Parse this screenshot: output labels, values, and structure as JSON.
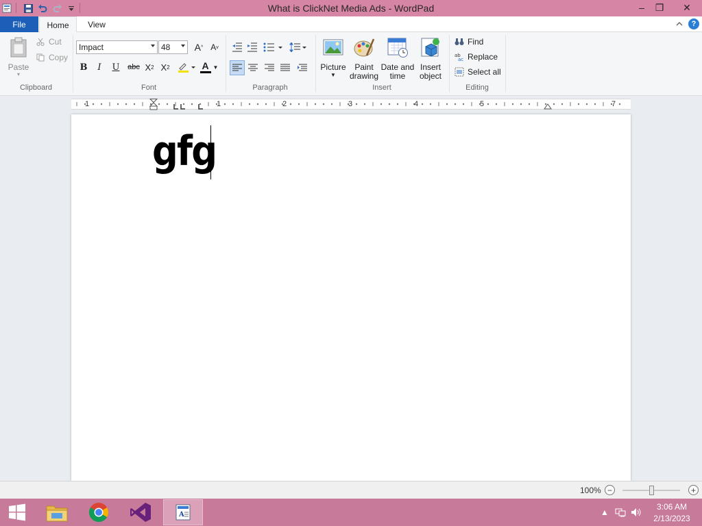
{
  "window": {
    "title": "What is ClickNet Media Ads - WordPad",
    "controls": {
      "minimize": "–",
      "maximize": "❐",
      "close": "✕"
    }
  },
  "ribbon": {
    "tabs": {
      "file": "File",
      "home": "Home",
      "view": "View"
    },
    "help": "?",
    "clipboard": {
      "group": "Clipboard",
      "paste": "Paste",
      "cut": "Cut",
      "copy": "Copy"
    },
    "font": {
      "group": "Font",
      "family": "Impact",
      "size": "48",
      "bold": "B",
      "italic": "I",
      "underline": "U",
      "strikethrough": "abc",
      "subscript_base": "X",
      "subscript_mark": "2",
      "superscript_base": "X",
      "superscript_mark": "2",
      "grow_base": "A",
      "grow_mark": "^",
      "shrink_base": "A",
      "shrink_mark": "v",
      "font_color_letter": "A",
      "font_color": "#000000",
      "highlight_color": "#f5e000"
    },
    "paragraph": {
      "group": "Paragraph"
    },
    "insert": {
      "group": "Insert",
      "picture": "Picture",
      "paint_line1": "Paint",
      "paint_line2": "drawing",
      "datetime_line1": "Date and",
      "datetime_line2": "time",
      "object_line1": "Insert",
      "object_line2": "object"
    },
    "editing": {
      "group": "Editing",
      "find": "Find",
      "replace": "Replace",
      "select_all": "Select all"
    }
  },
  "ruler": {
    "labels": [
      "1",
      "1",
      "2",
      "3",
      "4",
      "5",
      "7"
    ]
  },
  "document": {
    "text": "gfg"
  },
  "statusbar": {
    "zoom": "100%",
    "zoom_out": "−",
    "zoom_in": "+"
  },
  "taskbar": {
    "apps": [
      "start",
      "file-explorer",
      "chrome",
      "visual-studio",
      "wordpad"
    ],
    "time": "3:06 AM",
    "date": "2/13/2023",
    "tray_arrow": "▲"
  }
}
